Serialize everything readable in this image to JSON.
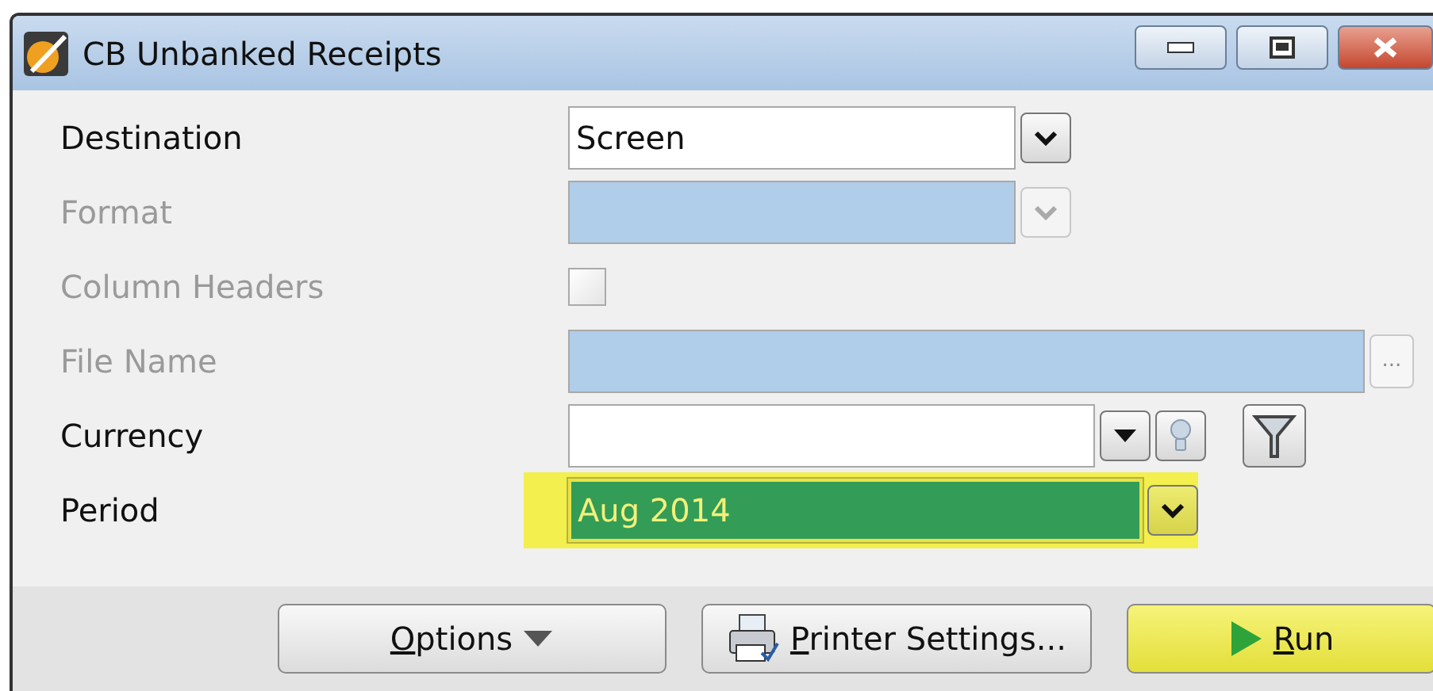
{
  "window": {
    "title": "CB Unbanked Receipts"
  },
  "fields": [
    {
      "label": "Destination",
      "kind": "dropdown",
      "value": "Screen",
      "disabled": false,
      "highlighted": false
    },
    {
      "label": "Format",
      "kind": "dropdown",
      "disabled": true,
      "highlighted": false
    },
    {
      "label": "Column Headers",
      "kind": "checkbox",
      "checked": false,
      "disabled": true,
      "highlighted": false
    },
    {
      "label": "File Name",
      "kind": "file",
      "browse_label": "...",
      "disabled": true,
      "highlighted": false
    },
    {
      "label": "Currency",
      "kind": "lookup",
      "disabled": false,
      "highlighted": false
    },
    {
      "label": "Period",
      "kind": "dropdown",
      "value": "Aug 2014",
      "disabled": false,
      "highlighted": true
    }
  ],
  "buttons": [
    {
      "label": "Options",
      "kind": "menu",
      "underline_first_letter": true,
      "highlighted": false
    },
    {
      "label": "Printer Settings...",
      "kind": "printer",
      "underline_first_letter": true,
      "highlighted": false
    },
    {
      "label": "Run",
      "kind": "run",
      "underline_first_letter": true,
      "highlighted": true
    }
  ]
}
